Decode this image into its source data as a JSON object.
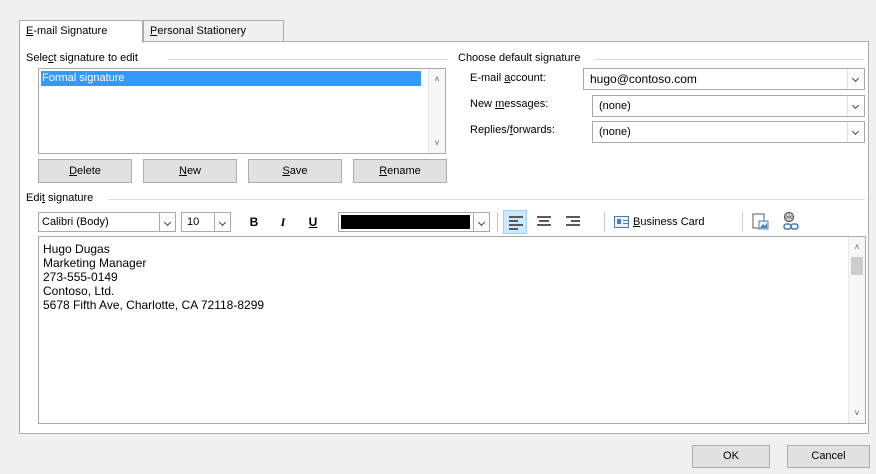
{
  "tabs": [
    {
      "label_pre": "",
      "label_ul": "E",
      "label_post": "-mail Signature",
      "active": true
    },
    {
      "label_pre": "",
      "label_ul": "P",
      "label_post": "ersonal Stationery",
      "active": false
    }
  ],
  "select_group": {
    "title_pre": "Sele",
    "title_ul": "c",
    "title_post": "t signature to edit"
  },
  "signatures": [
    "Formal signature"
  ],
  "sig_buttons": {
    "delete": {
      "pre": "",
      "ul": "D",
      "post": "elete"
    },
    "new": {
      "pre": "",
      "ul": "N",
      "post": "ew"
    },
    "save": {
      "pre": "",
      "ul": "S",
      "post": "ave"
    },
    "rename": {
      "pre": "",
      "ul": "R",
      "post": "ename"
    }
  },
  "default_group": {
    "title": "Choose default signature",
    "account_label_pre": "E-mail ",
    "account_label_ul": "a",
    "account_label_post": "ccount:",
    "account_value": "hugo@contoso.com",
    "new_label_pre": "New ",
    "new_label_ul": "m",
    "new_label_post": "essages:",
    "new_value": "(none)",
    "reply_label_pre": "Replies/",
    "reply_label_ul": "f",
    "reply_label_post": "orwards:",
    "reply_value": "(none)"
  },
  "edit_group": {
    "title_pre": "Edi",
    "title_ul": "t",
    "title_post": " signature"
  },
  "toolbar": {
    "font": "Calibri (Body)",
    "size": "10",
    "bold": "B",
    "italic": "I",
    "underline": "U",
    "text_color": "#000000",
    "business_card_pre": "",
    "business_card_ul": "B",
    "business_card_post": "usiness Card"
  },
  "signature_lines": [
    "Hugo Dugas",
    "Marketing Manager",
    "273-555-0149",
    "Contoso, Ltd.",
    "5678 Fifth Ave, Charlotte, CA 72118-8299"
  ],
  "footer": {
    "ok": "OK",
    "cancel": "Cancel"
  },
  "colors": {
    "selection": "#3399ff",
    "accent": "#0078d7"
  }
}
